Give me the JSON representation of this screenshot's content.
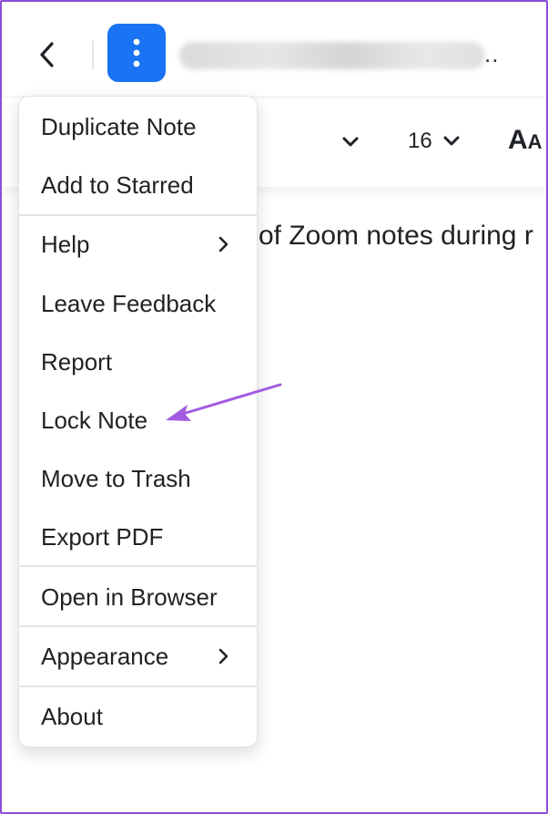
{
  "header": {
    "back_icon": "chevron-left-icon",
    "more_icon": "vertical-dots-icon",
    "title_ellipsis": "..",
    "accent_color": "#1a73f2"
  },
  "toolbar": {
    "font_size": "16",
    "text_style_big": "A",
    "text_style_small": "A"
  },
  "note": {
    "text": "of Zoom notes during r"
  },
  "menu": {
    "items": [
      {
        "label": "Duplicate Note"
      },
      {
        "label": "Add to Starred"
      },
      {
        "label": "Help",
        "has_submenu": true
      },
      {
        "label": "Leave Feedback"
      },
      {
        "label": "Report"
      },
      {
        "label": "Lock Note"
      },
      {
        "label": "Move to Trash"
      },
      {
        "label": "Export PDF"
      },
      {
        "label": "Open in Browser"
      },
      {
        "label": "Appearance",
        "has_submenu": true
      },
      {
        "label": "About"
      }
    ]
  },
  "annotation": {
    "arrow_color": "#a25be0",
    "target": "Lock Note"
  }
}
